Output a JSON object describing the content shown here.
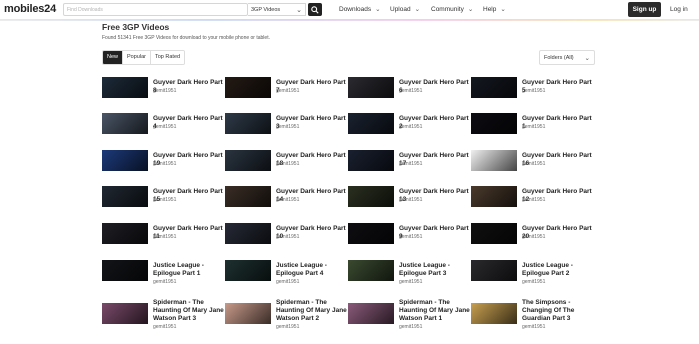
{
  "header": {
    "logo": "mobiles24",
    "search_placeholder": "Find Downloads",
    "search_category": "3GP Videos",
    "nav": [
      "Downloads",
      "Upload",
      "Community",
      "Help"
    ],
    "signup": "Sign up",
    "login": "Log in"
  },
  "page": {
    "title": "Free 3GP Videos",
    "subtitle": "Found 51341 Free 3GP Videos for download to your mobile phone or tablet.",
    "tabs": [
      "New",
      "Popular",
      "Top Rated"
    ],
    "active_tab": "New",
    "folder_filter": "Folders (All)"
  },
  "videos": [
    {
      "title": "Guyver Dark Hero Part 8",
      "user": "gemit1951",
      "thumb_color": "#1d2b3a"
    },
    {
      "title": "Guyver Dark Hero Part 7",
      "user": "gemit1951",
      "thumb_color": "#241a14"
    },
    {
      "title": "Guyver Dark Hero Part 6",
      "user": "gemit1951",
      "thumb_color": "#2a2a30"
    },
    {
      "title": "Guyver Dark Hero Part 5",
      "user": "gemit1951",
      "thumb_color": "#141820"
    },
    {
      "title": "Guyver Dark Hero Part 4",
      "user": "gemit1951",
      "thumb_color": "#4a5566"
    },
    {
      "title": "Guyver Dark Hero Part 3",
      "user": "gemit1951",
      "thumb_color": "#2e3a48"
    },
    {
      "title": "Guyver Dark Hero Part 2",
      "user": "gemit1951",
      "thumb_color": "#1a2230"
    },
    {
      "title": "Guyver Dark Hero Part 1",
      "user": "gemit1951",
      "thumb_color": "#0c0c12"
    },
    {
      "title": "Guyver Dark Hero Part 19",
      "user": "gemit1951",
      "thumb_color": "#1c3a7a"
    },
    {
      "title": "Guyver Dark Hero Part 18",
      "user": "gemit1951",
      "thumb_color": "#2a3440"
    },
    {
      "title": "Guyver Dark Hero Part 17",
      "user": "gemit1951",
      "thumb_color": "#1a2030"
    },
    {
      "title": "Guyver Dark Hero Part 16",
      "user": "gemit1951",
      "thumb_color": "#f0f0f0"
    },
    {
      "title": "Guyver Dark Hero Part 15",
      "user": "gemit1951",
      "thumb_color": "#202832"
    },
    {
      "title": "Guyver Dark Hero Part 14",
      "user": "gemit1951",
      "thumb_color": "#3a2e26"
    },
    {
      "title": "Guyver Dark Hero Part 13",
      "user": "gemit1951",
      "thumb_color": "#2a3020"
    },
    {
      "title": "Guyver Dark Hero Part 12",
      "user": "gemit1951",
      "thumb_color": "#4a3a2c"
    },
    {
      "title": "Guyver Dark Hero Part 11",
      "user": "gemit1951",
      "thumb_color": "#1e1e24"
    },
    {
      "title": "Guyver Dark Hero Part 10",
      "user": "gemit1951",
      "thumb_color": "#262a36"
    },
    {
      "title": "Guyver Dark Hero Part 9",
      "user": "gemit1951",
      "thumb_color": "#0e0e12"
    },
    {
      "title": "Guyver Dark Hero Part 20",
      "user": "gemit1951",
      "thumb_color": "#101010"
    },
    {
      "title": "Justice League - Epilogue Part 1",
      "user": "gemit1951",
      "thumb_color": "#121418"
    },
    {
      "title": "Justice League - Epilogue Part 4",
      "user": "gemit1951",
      "thumb_color": "#1e3030"
    },
    {
      "title": "Justice League - Epilogue Part 3",
      "user": "gemit1951",
      "thumb_color": "#3a4a30"
    },
    {
      "title": "Justice League - Epilogue Part 2",
      "user": "gemit1951",
      "thumb_color": "#2a2a2e"
    },
    {
      "title": "Spiderman - The Haunting Of Mary Jane Watson Part 3",
      "user": "gemit1951",
      "thumb_color": "#7a4a6a"
    },
    {
      "title": "Spiderman - The Haunting Of Mary Jane Watson Part 2",
      "user": "gemit1951",
      "thumb_color": "#c89a8a"
    },
    {
      "title": "Spiderman - The Haunting Of Mary Jane Watson Part 1",
      "user": "gemit1951",
      "thumb_color": "#8a5a7a"
    },
    {
      "title": "The Simpsons - Changing Of The Guardian Part 3",
      "user": "gemit1951",
      "thumb_color": "#c8a050"
    }
  ]
}
